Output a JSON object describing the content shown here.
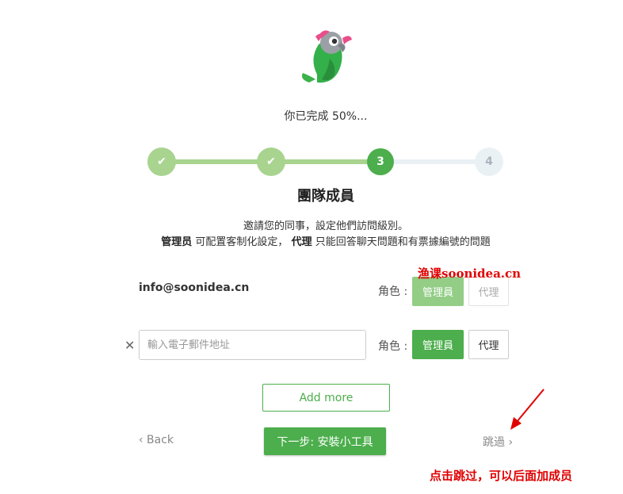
{
  "progress": {
    "text": "你已完成 50%..."
  },
  "stepper": {
    "steps": [
      {
        "state": "done",
        "label": "✔"
      },
      {
        "state": "done",
        "label": "✔"
      },
      {
        "state": "current",
        "label": "3"
      },
      {
        "state": "todo",
        "label": "4"
      }
    ]
  },
  "section": {
    "title": "團隊成員",
    "description": "邀請您的同事，設定他們訪問級別。",
    "roles_note": {
      "admin_term": "管理员",
      "admin_text": " 可配置客制化設定，",
      "agent_term": "代理",
      "agent_text": " 只能回答聊天問題和有票據編號的問題"
    }
  },
  "members": [
    {
      "email": "info@soonidea.cn",
      "role_label": "角色 :",
      "admin_label": "管理員",
      "agent_label": "代理"
    }
  ],
  "new_member": {
    "placeholder": "輸入電子郵件地址",
    "value": "",
    "role_label": "角色 :",
    "admin_label": "管理員",
    "agent_label": "代理"
  },
  "actions": {
    "add_more": "Add more",
    "back": "‹ Back",
    "next": "下一步: 安裝小工具",
    "skip": "跳過 ›"
  },
  "overlay": {
    "watermark": "渔课soonidea.cn",
    "annotation": "点击跳过，可以后面加成员",
    "color": "#e00000"
  },
  "colors": {
    "accent": "#4cae4c",
    "accent_light": "#a8d48f"
  }
}
